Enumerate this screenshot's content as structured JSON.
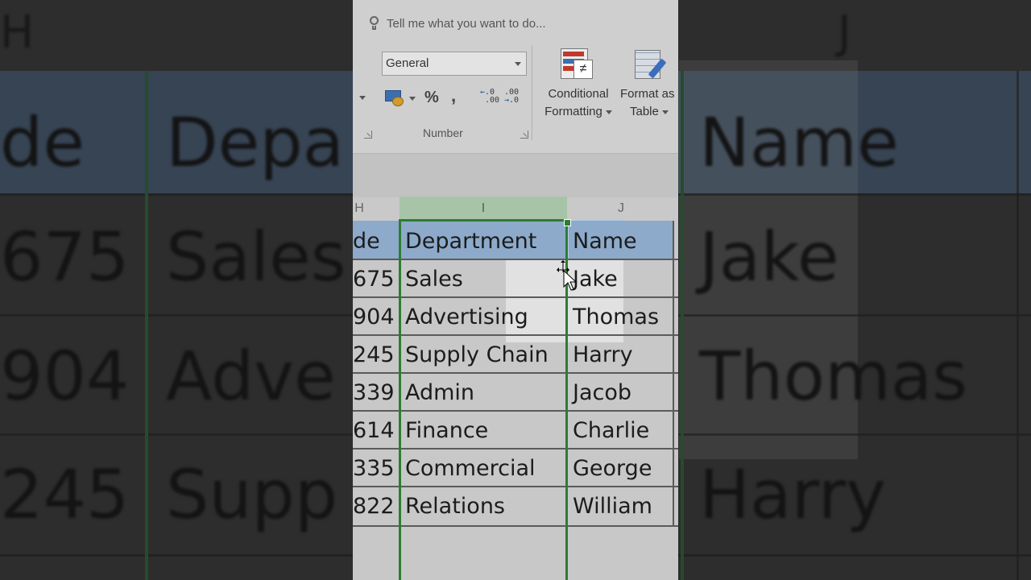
{
  "background": {
    "col_h": "H",
    "col_j": "J",
    "cells_left": [
      "de",
      "675",
      "904",
      "245"
    ],
    "cells_mid": [
      "Depa",
      "Sales",
      "Adve",
      "Supp"
    ],
    "cells_right": [
      "Name",
      "Jake",
      "Thomas",
      "Harry"
    ]
  },
  "ribbon": {
    "tell_me": "Tell me what you want to do...",
    "number_format": "General",
    "percent": "%",
    "comma": ",",
    "inc_decimal": ".0\n.00",
    "dec_decimal": ".00\n.0",
    "number_group": "Number",
    "conditional_line1": "Conditional",
    "conditional_line2": "Formatting",
    "format_line1": "Format as",
    "format_line2": "Table",
    "not_equal": "≠"
  },
  "sheet": {
    "columns": {
      "h": "H",
      "i": "I",
      "j": "J"
    },
    "rows": [
      {
        "code": "de",
        "department": "Department",
        "name": "Name"
      },
      {
        "code": "675",
        "department": "Sales",
        "name": "Jake"
      },
      {
        "code": "904",
        "department": "Advertising",
        "name": "Thomas"
      },
      {
        "code": "245",
        "department": "Supply Chain",
        "name": "Harry"
      },
      {
        "code": "339",
        "department": "Admin",
        "name": "Jacob"
      },
      {
        "code": "614",
        "department": "Finance",
        "name": "Charlie"
      },
      {
        "code": "335",
        "department": "Commercial",
        "name": "George"
      },
      {
        "code": "822",
        "department": "Relations",
        "name": "William"
      }
    ]
  },
  "colors": {
    "selection_green": "#2e7d32",
    "header_blue": "#8daacb"
  }
}
